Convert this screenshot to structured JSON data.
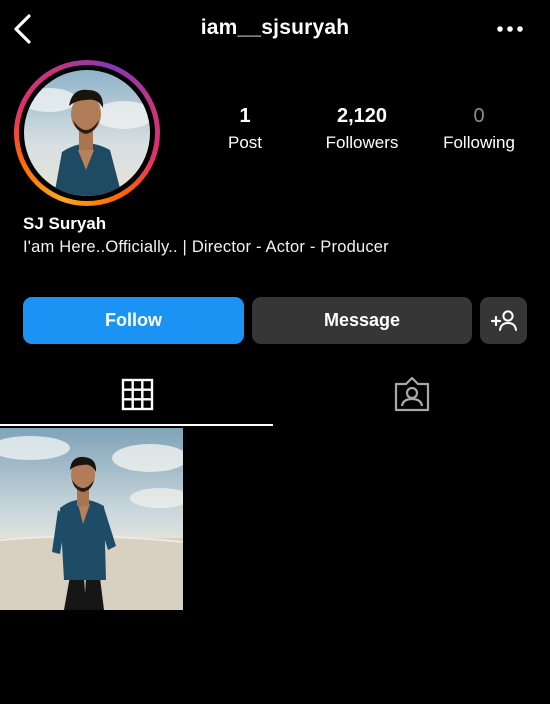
{
  "header": {
    "username": "iam__sjsuryah",
    "back_icon": "chevron-left-icon",
    "more_icon": "more-horizontal-icon"
  },
  "profile": {
    "display_name": "SJ Suryah",
    "bio": "I'am Here..Officially.. | Director - Actor - Producer",
    "story_ring_colors": [
      "#f9a825",
      "#ff6a00",
      "#e1306c",
      "#c13584",
      "#833ab4"
    ]
  },
  "stats": {
    "posts": {
      "value": "1",
      "label": "Post"
    },
    "followers": {
      "value": "2,120",
      "label": "Followers"
    },
    "following": {
      "value": "0",
      "label": "Following"
    }
  },
  "actions": {
    "follow_label": "Follow",
    "message_label": "Message",
    "add_user_icon": "add-user-icon",
    "follow_color": "#1a93f5",
    "secondary_color": "#363636"
  },
  "tabs": [
    {
      "icon": "grid-icon",
      "active": true
    },
    {
      "icon": "tagged-person-icon",
      "active": false
    }
  ]
}
